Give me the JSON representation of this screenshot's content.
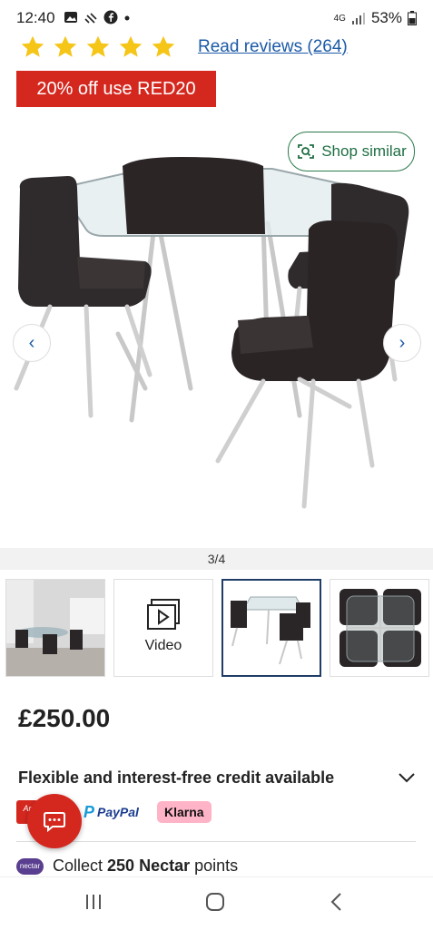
{
  "status_bar": {
    "time": "12:40",
    "network": "4G",
    "battery": "53%",
    "left_icons": [
      "image-notification-icon",
      "missed-call-icon",
      "facebook-icon",
      "dot-icon"
    ]
  },
  "rating": {
    "stars": 5,
    "reviews_label": "Read reviews (264)"
  },
  "promo": {
    "label": "20% off use RED20",
    "color": "#d4281f"
  },
  "gallery": {
    "shop_similar_label": "Shop similar",
    "counter": "3/4",
    "prev_icon": "chevron-left-icon",
    "next_icon": "chevron-right-icon"
  },
  "thumbnails": [
    {
      "name": "thumbnail-room-photo"
    },
    {
      "name": "thumbnail-video",
      "label": "Video"
    },
    {
      "name": "thumbnail-product-angle",
      "selected": true
    },
    {
      "name": "thumbnail-top-view"
    }
  ],
  "price": "£250.00",
  "credit": {
    "text": "Flexible and interest-free credit available"
  },
  "payments": {
    "argos": "Ar",
    "paypal": "PayPal",
    "klarna": "Klarna"
  },
  "nectar": {
    "badge": "nectar",
    "prefix": "Collect ",
    "points": "250 Nectar",
    "suffix": " points"
  },
  "colors": {
    "accent_red": "#d4281f",
    "link_blue": "#1c5aa6",
    "star_yellow": "#f5c518",
    "shop_green": "#1e6e42"
  }
}
